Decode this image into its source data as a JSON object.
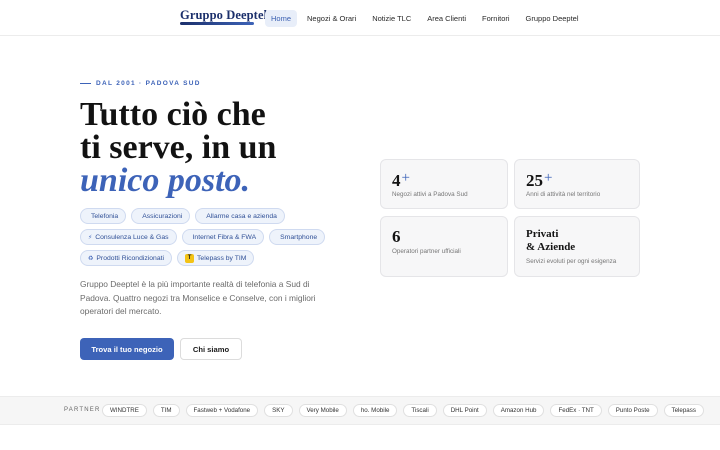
{
  "brand": {
    "name": "Gruppo Deeptel"
  },
  "nav": {
    "items": [
      {
        "label": "Home",
        "active": true
      },
      {
        "label": "Negozi & Orari"
      },
      {
        "label": "Notizie TLC"
      },
      {
        "label": "Area Clienti"
      },
      {
        "label": "Fornitori"
      },
      {
        "label": "Gruppo Deeptel"
      }
    ]
  },
  "hero": {
    "eyebrow": "DAL 2001 · PADOVA SUD",
    "headline": {
      "line1": "Tutto ciò che",
      "line2": "ti serve, in un",
      "line3": "unico posto."
    },
    "chips": [
      {
        "label": "Telefonia",
        "icon": "phone-icon",
        "glyph": ""
      },
      {
        "label": "Assicurazioni",
        "icon": "shield-icon",
        "glyph": ""
      },
      {
        "label": "Allarme casa e azienda",
        "icon": "home-alarm-icon",
        "glyph": ""
      },
      {
        "label": "Consulenza Luce & Gas",
        "icon": "bolt-icon",
        "glyph": "⚡"
      },
      {
        "label": "Internet Fibra & FWA",
        "icon": "wifi-icon",
        "glyph": ""
      },
      {
        "label": "Smartphone",
        "icon": "smartphone-icon",
        "glyph": ""
      },
      {
        "label": "Prodotti Ricondizionati",
        "icon": "recycle-icon",
        "glyph": "♻"
      },
      {
        "label": "Telepass by TIM",
        "icon": "telepass-badge-icon",
        "glyph": "T"
      }
    ],
    "intro": "Gruppo Deeptel è la più importante realtà di telefonia a Sud di Padova. Quattro negozi tra Monselice e Conselve, con i migliori operatori del mercato.",
    "primary_cta": "Trova il tuo negozio",
    "secondary_cta": "Chi siamo"
  },
  "stats": [
    {
      "value": "4",
      "suffix": "+",
      "label": "Negozi attivi a Padova Sud"
    },
    {
      "value": "25",
      "suffix": "+",
      "label": "Anni di attività nel territorio"
    },
    {
      "value": "6",
      "suffix": "",
      "label": "Operatori partner ufficiali"
    },
    {
      "title_line1": "Privati",
      "title_line2": "& Aziende",
      "label": "Servizi evoluti per ogni esigenza"
    }
  ],
  "partners": {
    "label": "PARTNER",
    "items": [
      "WINDTRE",
      "TIM",
      "Fastweb + Vodafone",
      "SKY",
      "Very Mobile",
      "ho. Mobile",
      "Tiscali",
      "DHL Point",
      "Amazon Hub",
      "FedEx · TNT",
      "Punto Poste",
      "Telepass"
    ]
  },
  "colors": {
    "accent": "#3d63b8",
    "brand_dark": "#1b2f6b",
    "telepass_yellow": "#f3c316"
  }
}
